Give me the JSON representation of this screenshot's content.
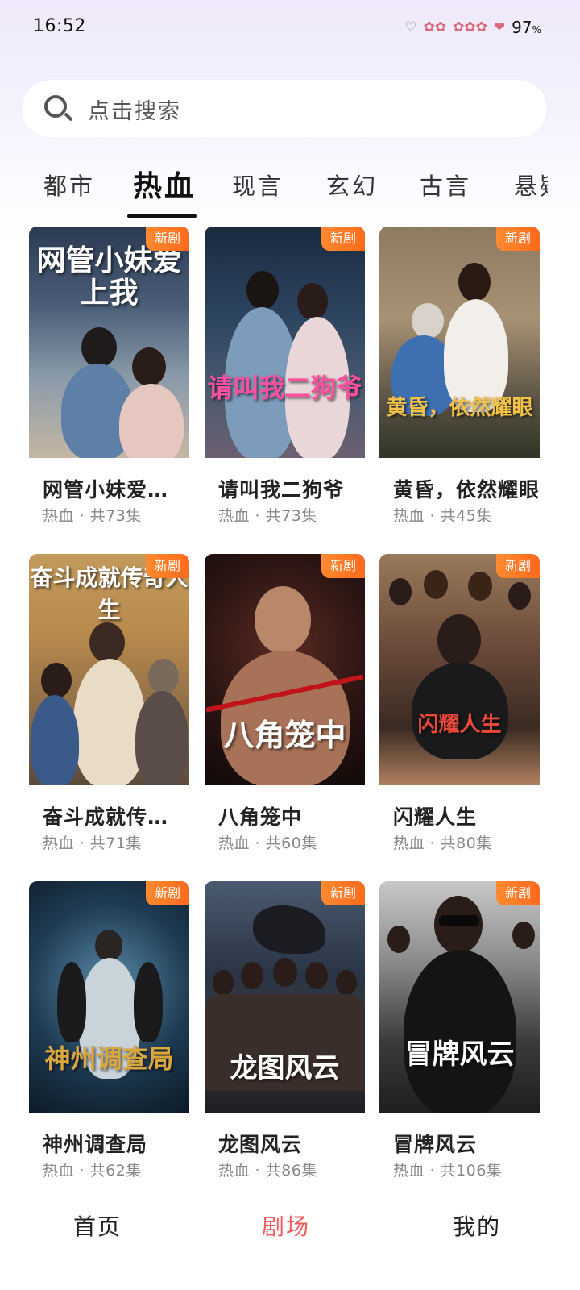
{
  "status_bar": {
    "time": "16:52",
    "battery": "97",
    "battery_unit": "%"
  },
  "search": {
    "placeholder": "点击搜索"
  },
  "tabs": [
    {
      "label": "都市"
    },
    {
      "label": "热血"
    },
    {
      "label": "现言"
    },
    {
      "label": "玄幻"
    },
    {
      "label": "古言"
    },
    {
      "label": "悬疑"
    }
  ],
  "active_tab": "热血",
  "badge_label": "新剧",
  "cards": [
    {
      "title": "网管小妹爱…",
      "poster_text": "网管小妹爱上我",
      "genre": "热血",
      "episodes": "共73集"
    },
    {
      "title": "请叫我二狗爷",
      "poster_text": "请叫我二狗爷",
      "genre": "热血",
      "episodes": "共73集"
    },
    {
      "title": "黄昏，依然耀眼",
      "poster_text": "黄昏，依然耀眼",
      "genre": "热血",
      "episodes": "共45集"
    },
    {
      "title": "奋斗成就传…",
      "poster_text": "奋斗成就传奇人生",
      "genre": "热血",
      "episodes": "共71集"
    },
    {
      "title": "八角笼中",
      "poster_text": "八角笼中",
      "genre": "热血",
      "episodes": "共60集"
    },
    {
      "title": "闪耀人生",
      "poster_text": "闪耀人生",
      "genre": "热血",
      "episodes": "共80集"
    },
    {
      "title": "神州调查局",
      "poster_text": "神州调查局",
      "genre": "热血",
      "episodes": "共62集"
    },
    {
      "title": "龙图风云",
      "poster_text": "龙图风云",
      "genre": "热血",
      "episodes": "共86集"
    },
    {
      "title": "冒牌风云",
      "poster_text": "冒牌风云",
      "genre": "热血",
      "episodes": "共106集"
    }
  ],
  "meta_separator": " · ",
  "bottom_nav": [
    {
      "label": "首页"
    },
    {
      "label": "剧场"
    },
    {
      "label": "我的"
    }
  ],
  "colors": {
    "accent": "#ef5a5a",
    "badge": "#ff7a24"
  }
}
